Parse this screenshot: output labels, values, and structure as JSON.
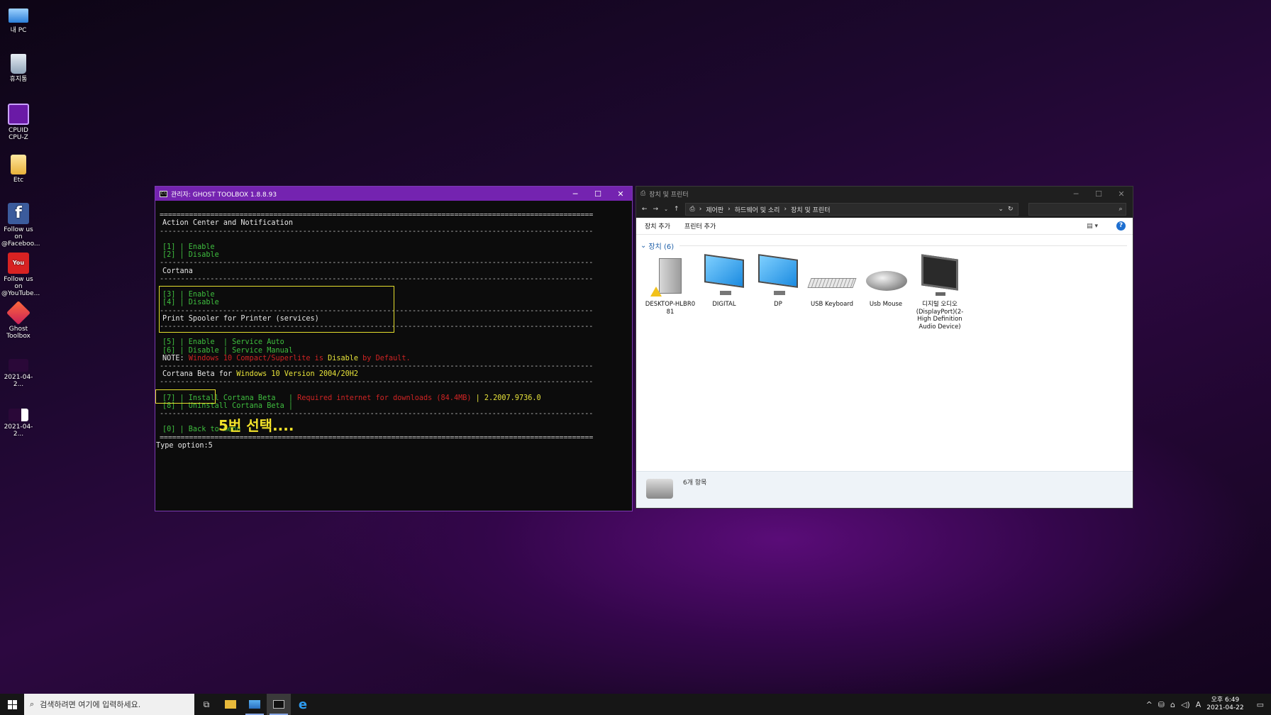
{
  "desktop": {
    "icons": [
      {
        "label": "내 PC"
      },
      {
        "label": "휴지통"
      },
      {
        "label": "CPUID\nCPU-Z"
      },
      {
        "label": "Etc"
      },
      {
        "label": "Follow us on\n@Faceboo..."
      },
      {
        "label": "Follow us on\n@YouTube..."
      },
      {
        "label": "Ghost\nToolbox"
      },
      {
        "label": "2021-04-2..."
      },
      {
        "label": "2021-04-2..."
      }
    ]
  },
  "console": {
    "title": "관리자:  GHOST TOOLBOX 1.8.8.93",
    "sections": {
      "action_center": "Action Center and Notification",
      "opt1": "[1] | Enable",
      "opt2": "[2] | Disable",
      "cortana": "Cortana",
      "opt3": "[3] | Enable",
      "opt4": "[4] | Disable",
      "spooler": "Print Spooler for Printer (services)",
      "opt5": "[5] | Enable  | Service Auto",
      "opt6": "[6] | Disable | Service Manual",
      "note_label": "NOTE: ",
      "note_a": "Windows 10 Compact/Superlite is ",
      "note_b": "Disable",
      "note_c": " by Default.",
      "cortana_beta_a": "Cortana Beta for ",
      "cortana_beta_b": "Windows 10 Version 2004/20H2",
      "opt7_a": "[7] | Install Cortana Beta   | ",
      "opt7_b": "Required internet for downloads (84.4MB)",
      "opt7_c": " | 2.2007.9736.0",
      "opt8": "[8] | Uninstall Cortana Beta |",
      "opt0": "[0] | Back to menu",
      "prompt": "Type option:5"
    },
    "annotation": "5번 선택...."
  },
  "explorer": {
    "title": "장치 및 프린터",
    "breadcrumb": [
      "제어판",
      "하드웨어 및 소리",
      "장치 및 프린터"
    ],
    "commands": {
      "add_device": "장치 추가",
      "add_printer": "프린터 추가"
    },
    "group": "장치 (6)",
    "devices": [
      {
        "label": "DESKTOP-HLBR0\n81",
        "icon": "computer-icon"
      },
      {
        "label": "DIGITAL",
        "icon": "monitor-icon"
      },
      {
        "label": "DP",
        "icon": "monitor-icon"
      },
      {
        "label": "USB Keyboard",
        "icon": "keyboard-icon"
      },
      {
        "label": "Usb Mouse",
        "icon": "mouse-icon"
      },
      {
        "label": "디지털 오디오\n(DisplayPort)(2-\nHigh Definition\nAudio Device)",
        "icon": "display-audio-icon"
      }
    ],
    "status_count": "6개 항목"
  },
  "taskbar": {
    "search_placeholder": "검색하려면 여기에 입력하세요.",
    "tray_lang": "A",
    "time": "오후 6:49",
    "date": "2021-04-22"
  }
}
